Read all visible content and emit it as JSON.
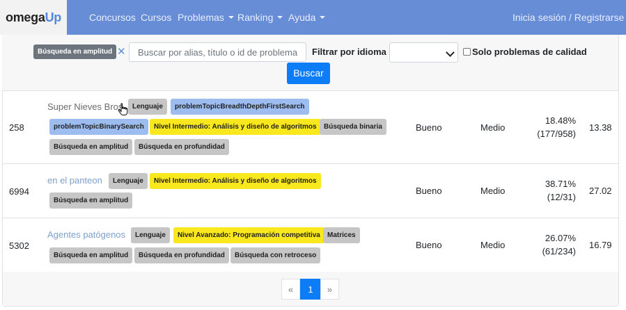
{
  "navbar": {
    "brand_omega": "omega",
    "brand_up": "Up",
    "items": [
      {
        "label": "Concursos"
      },
      {
        "label": "Cursos"
      },
      {
        "label": "Problemas"
      },
      {
        "label": "Ranking"
      },
      {
        "label": "Ayuda"
      }
    ],
    "login": "Inicia sesión / Registrarse"
  },
  "filters": {
    "active_tag": "Búsqueda en amplitud",
    "remove_symbol": "✕",
    "search_placeholder": "Buscar por alias, título o id de problema",
    "language_label": "Filtrar por idioma",
    "language_value": "",
    "quality_label": "Solo problemas de calidad",
    "quality_checked": false,
    "search_button": "Buscar"
  },
  "problems": [
    {
      "id": "258",
      "title": "Super Nieves Bros",
      "tags": [
        "Lenguaje",
        "problemTopicBreadthDepthFirstSearch",
        "problemTopicBinarySearch",
        "Nivel Intermedio: Análisis y diseño de algoritmos",
        "Búsqueda binaria",
        "Búsqueda en amplitud",
        "Búsqueda en profundidad"
      ],
      "quality": "Bueno",
      "difficulty": "Medio",
      "ratio": "18.48%",
      "ratio_detail": "(177/958)",
      "points": "13.38"
    },
    {
      "id": "6994",
      "title": "en el panteon",
      "tags": [
        "Lenguaje",
        "Nivel Intermedio: Análisis y diseño de algoritmos",
        "Búsqueda en amplitud"
      ],
      "quality": "Bueno",
      "difficulty": "Medio",
      "ratio": "38.71%",
      "ratio_detail": "(12/31)",
      "points": "27.02"
    },
    {
      "id": "5302",
      "title": "Agentes patógenos",
      "tags": [
        "Lenguaje",
        "Nivel Avanzado: Programación competitiva",
        "Matrices",
        "Búsqueda en amplitud",
        "Búsqueda en profundidad",
        "Búsqueda con retroceso"
      ],
      "quality": "Bueno",
      "difficulty": "Medio",
      "ratio": "26.07%",
      "ratio_detail": "(61/234)",
      "points": "16.79"
    }
  ],
  "pagination": {
    "prev": "«",
    "current": "1",
    "next": "»"
  },
  "colors": {
    "navbar": "#678dd7",
    "primary": "#0d7df7",
    "tag_gray": "#c6c6c6",
    "tag_blue": "#9dbcf0",
    "tag_yellow": "#fae81e"
  }
}
